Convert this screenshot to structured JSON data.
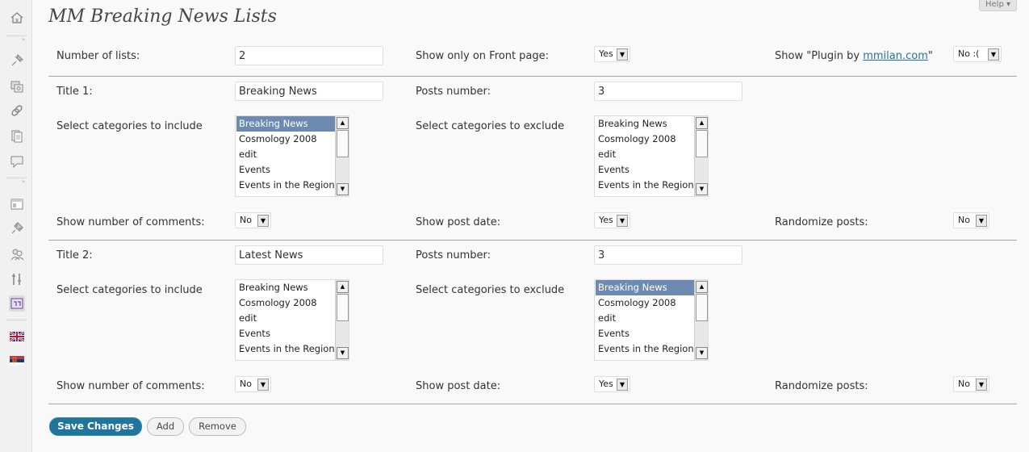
{
  "page": {
    "title": "MM Breaking News Lists",
    "help": "Help ▾"
  },
  "global": {
    "num_lists_label": "Number of lists:",
    "num_lists_value": "2",
    "front_page_label": "Show only on Front page:",
    "front_page_value": "Yes",
    "plugin_by_prefix": "Show \"Plugin by ",
    "plugin_by_link": "mmilan.com",
    "plugin_by_suffix": "\"",
    "plugin_by_value": "No :("
  },
  "category_options": [
    "Breaking News",
    "Cosmology 2008",
    "edit",
    "Events",
    "Events in the Region"
  ],
  "lists": [
    {
      "title_label": "Title 1:",
      "title_value": "Breaking News",
      "posts_label": "Posts number:",
      "posts_value": "3",
      "include_label": "Select categories to include",
      "exclude_label": "Select categories to exclude",
      "include_selected": "Breaking News",
      "exclude_selected": "",
      "comments_label": "Show number of comments:",
      "comments_value": "No",
      "date_label": "Show post date:",
      "date_value": "Yes",
      "random_label": "Randomize posts:",
      "random_value": "No"
    },
    {
      "title_label": "Title 2:",
      "title_value": "Latest News",
      "posts_label": "Posts number:",
      "posts_value": "3",
      "include_label": "Select categories to include",
      "exclude_label": "Select categories to exclude",
      "include_selected": "",
      "exclude_selected": "Breaking News",
      "comments_label": "Show number of comments:",
      "comments_value": "No",
      "date_label": "Show post date:",
      "date_value": "Yes",
      "random_label": "Randomize posts:",
      "random_value": "No"
    }
  ],
  "buttons": {
    "save": "Save Changes",
    "add": "Add",
    "remove": "Remove"
  },
  "sidebar": {
    "icons": [
      "dashboard-icon",
      "posts-icon",
      "media-icon",
      "links-icon",
      "pages-icon",
      "comments-icon",
      "appearance-icon",
      "plugins-icon",
      "users-icon",
      "tools-icon",
      "settings-icon",
      "flag-uk-icon",
      "flag-serbia-icon"
    ]
  }
}
